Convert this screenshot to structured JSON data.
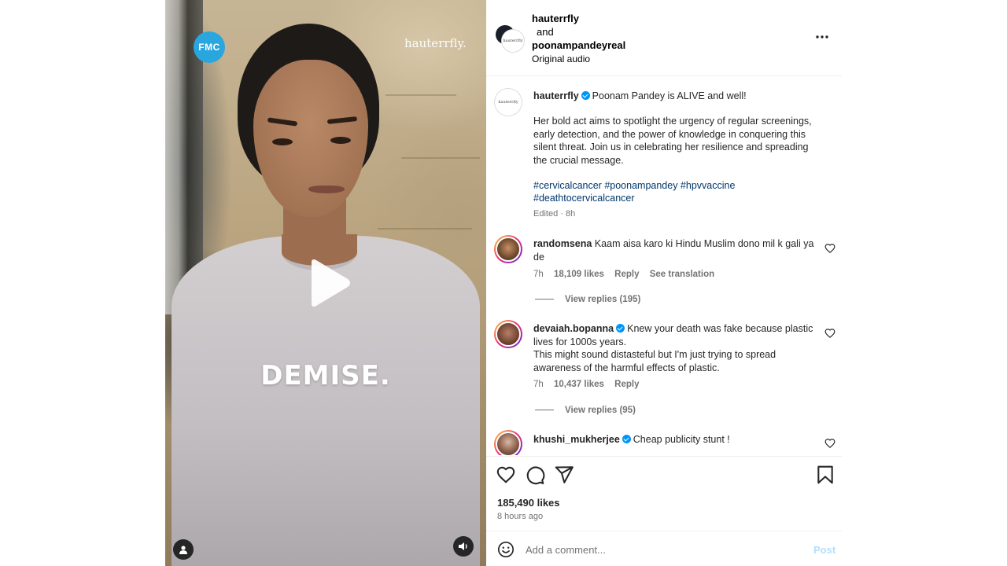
{
  "video": {
    "overlay_text": "DEMISE.",
    "brand_logo_text": "FMC",
    "watermark": "hauterrfly."
  },
  "header": {
    "author1": "hauterrfly",
    "connector": "and",
    "author2": "poonampandeyreal",
    "audio": "Original audio",
    "avatar_text": "hauterrfly"
  },
  "caption": {
    "username": "hauterrfly",
    "headline": "Poonam Pandey is ALIVE and well!",
    "body": "Her bold act aims to spotlight the urgency of regular screenings, early detection, and the power of knowledge in conquering this silent threat. Join us in celebrating her resilience and spreading the crucial message.",
    "hashtags_line1": "#cervicalcancer #poonampandey #hpvvaccine",
    "hashtags_line2": "#deathtocervicalcancer",
    "edited": "Edited · 8h"
  },
  "comments": [
    {
      "username": "randomsena",
      "text": "Kaam aisa karo ki Hindu Muslim dono mil k gali ya de",
      "time": "7h",
      "likes": "18,109 likes",
      "reply": "Reply",
      "translate": "See translation",
      "view_replies": "View replies (195)"
    },
    {
      "username": "devaiah.bopanna",
      "text_line1": "Knew your death was fake because plastic lives for 1000s years.",
      "text_line2": "This might sound distasteful but I'm just trying to spread awareness of the harmful effects of plastic.",
      "time": "7h",
      "likes": "10,437 likes",
      "reply": "Reply",
      "view_replies": "View replies (95)"
    },
    {
      "username": "khushi_mukherjee",
      "text": "Cheap publicity stunt !"
    }
  ],
  "actions": {
    "likes": "185,490 likes",
    "time_ago": "8 hours ago"
  },
  "comment_box": {
    "placeholder": "Add a comment...",
    "post_label": "Post"
  },
  "colors": {
    "verified": "#0095f6",
    "link": "#00376b",
    "post_disabled": "#b2dffc",
    "secondary_text": "#737373"
  }
}
